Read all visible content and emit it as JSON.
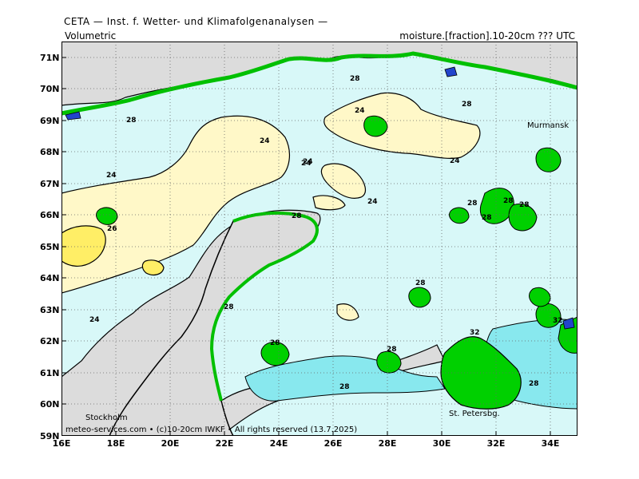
{
  "header": {
    "title": "CETA — Inst. f. Wetter- und Klimafolgenanalysen —",
    "left_label": "Volumetric",
    "right_label": "moisture.[fraction].10-20cm ??? UTC"
  },
  "axes": {
    "lat_labels": [
      "71N",
      "70N",
      "69N",
      "68N",
      "67N",
      "66N",
      "65N",
      "64N",
      "63N",
      "62N",
      "61N",
      "60N",
      "59N"
    ],
    "lon_labels": [
      "16E",
      "18E",
      "20E",
      "22E",
      "24E",
      "26E",
      "28E",
      "30E",
      "32E",
      "34E"
    ]
  },
  "places": {
    "murmansk": "Murmansk",
    "stockholm": "Stockholm",
    "st_petersburg": "St. Petersbg."
  },
  "footer": "meteo-services.com • (c)10-20cm IWKF • All rights reserved (13.7.2025)",
  "contour_labels": [
    "24",
    "24",
    "24",
    "24",
    "24",
    "24",
    "24",
    "24",
    "26",
    "28",
    "28",
    "28",
    "28",
    "28",
    "28",
    "28",
    "28",
    "28",
    "28",
    "28",
    "28",
    "28",
    "28",
    "32",
    "32"
  ],
  "colors": {
    "land_gray": "#dcdcdc",
    "level_pale_cyan": "#d8f8f8",
    "level_cream": "#fff8c8",
    "level_yellow": "#ffee66",
    "level_cyan": "#88e8ee",
    "level_green": "#00d000",
    "level_blue": "#2244cc"
  }
}
